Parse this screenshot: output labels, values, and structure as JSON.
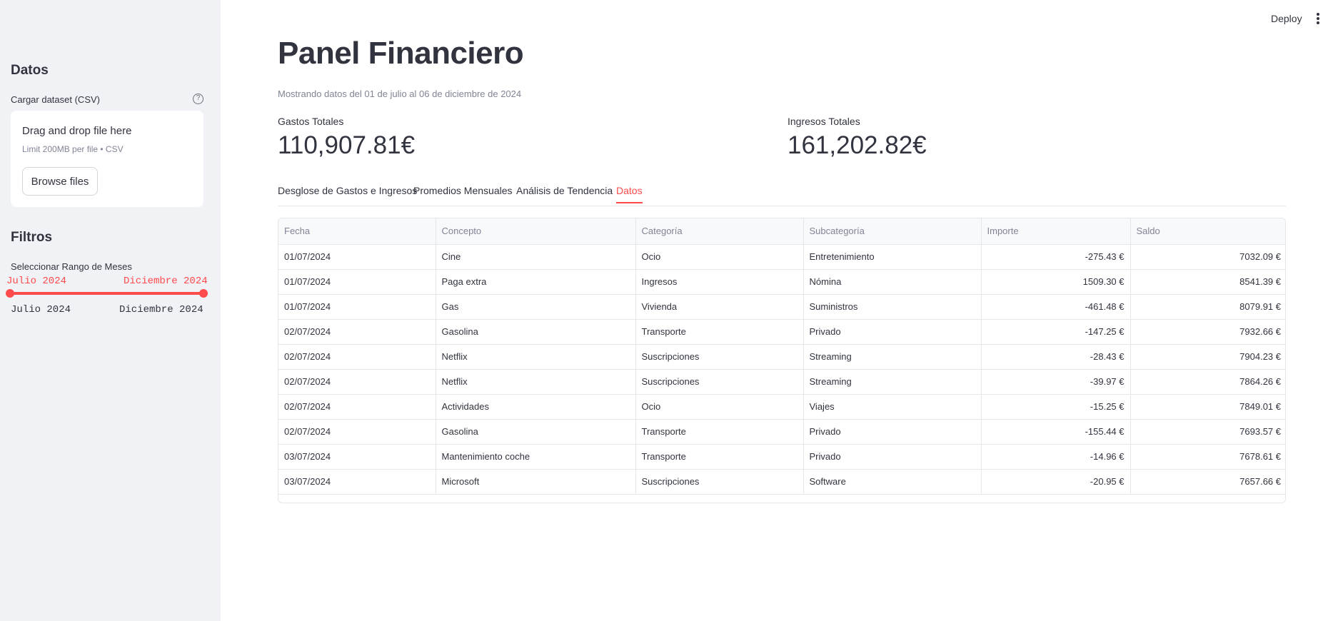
{
  "header": {
    "deploy_label": "Deploy",
    "menu_icon": "kebab-menu-icon"
  },
  "sidebar": {
    "datos_heading": "Datos",
    "upload_label": "Cargar dataset (CSV)",
    "help_icon": "question-circle-icon",
    "uploader": {
      "title": "Drag and drop file here",
      "limit": "Limit 200MB per file • CSV",
      "browse_label": "Browse files"
    },
    "filtros_heading": "Filtros",
    "slider_label": "Seleccionar Rango de Meses",
    "slider_value_start": "Julio 2024",
    "slider_value_end": "Diciembre 2024",
    "slider_min": "Julio 2024",
    "slider_max": "Diciembre 2024",
    "slider_position_start": 0.0,
    "slider_position_end": 1.0
  },
  "main": {
    "title": "Panel Financiero",
    "caption": "Mostrando datos del 01 de julio al 06 de diciembre de 2024",
    "metrics": [
      {
        "label": "Gastos Totales",
        "value": "110,907.81€"
      },
      {
        "label": "Ingresos Totales",
        "value": "161,202.82€"
      }
    ],
    "tabs": [
      {
        "label": "Desglose de Gastos e Ingresos",
        "active": false
      },
      {
        "label": "Promedios Mensuales",
        "active": false
      },
      {
        "label": "Análisis de Tendencia",
        "active": false
      },
      {
        "label": "Datos",
        "active": true
      }
    ],
    "accent_color": "#ff4b4b",
    "table": {
      "columns": [
        "Fecha",
        "Concepto",
        "Categoría",
        "Subcategoría",
        "Importe",
        "Saldo"
      ],
      "rows": [
        [
          "01/07/2024",
          "Cine",
          "Ocio",
          "Entretenimiento",
          "-275.43 €",
          "7032.09 €"
        ],
        [
          "01/07/2024",
          "Paga extra",
          "Ingresos",
          "Nómina",
          "1509.30 €",
          "8541.39 €"
        ],
        [
          "01/07/2024",
          "Gas",
          "Vivienda",
          "Suministros",
          "-461.48 €",
          "8079.91 €"
        ],
        [
          "02/07/2024",
          "Gasolina",
          "Transporte",
          "Privado",
          "-147.25 €",
          "7932.66 €"
        ],
        [
          "02/07/2024",
          "Netflix",
          "Suscripciones",
          "Streaming",
          "-28.43 €",
          "7904.23 €"
        ],
        [
          "02/07/2024",
          "Netflix",
          "Suscripciones",
          "Streaming",
          "-39.97 €",
          "7864.26 €"
        ],
        [
          "02/07/2024",
          "Actividades",
          "Ocio",
          "Viajes",
          "-15.25 €",
          "7849.01 €"
        ],
        [
          "02/07/2024",
          "Gasolina",
          "Transporte",
          "Privado",
          "-155.44 €",
          "7693.57 €"
        ],
        [
          "03/07/2024",
          "Mantenimiento coche",
          "Transporte",
          "Privado",
          "-14.96 €",
          "7678.61 €"
        ],
        [
          "03/07/2024",
          "Microsoft",
          "Suscripciones",
          "Software",
          "-20.95 €",
          "7657.66 €"
        ]
      ]
    }
  }
}
